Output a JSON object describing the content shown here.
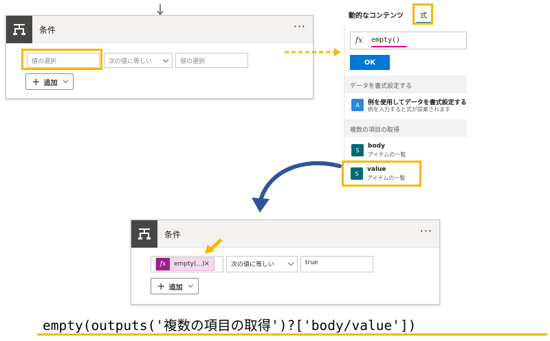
{
  "top_card": {
    "title": "条件",
    "more": "···",
    "field1_placeholder": "値の選択",
    "operator": "次の値に等しい",
    "field2_placeholder": "値の選択",
    "add_label": "追加"
  },
  "panel": {
    "tab_dynamic": "動的なコンテンツ",
    "tab_expression": "式",
    "fx_symbol": "fx",
    "expression_value": "empty()",
    "ok_label": "OK",
    "section_format": "データを書式設定する",
    "format_item_title": "例を使用してデータを書式設定する",
    "format_item_sub": "例を入力すると式が提案されます",
    "section_get_items": "複数の項目の取得",
    "items": [
      {
        "title": "body",
        "sub": "アイテムの一覧"
      },
      {
        "title": "value",
        "sub": "アイテムの一覧"
      }
    ]
  },
  "bottom_card": {
    "title": "条件",
    "more": "···",
    "token_fx": "fx",
    "token_label": "empty(...)",
    "token_remove": "×",
    "operator": "次の値に等しい",
    "value": "true",
    "add_label": "追加"
  },
  "expression_caption": "empty(outputs('複数の項目の取得')?['body/value'])",
  "colors": {
    "highlight": "#f4b800",
    "accent_blue": "#0078d4",
    "arrow_blue": "#2f5597",
    "sharepoint_teal": "#036c70",
    "token_purple": "#9b1f8b"
  },
  "icons": [
    "condition-icon",
    "plus-icon",
    "chevron-down-icon",
    "fx-icon",
    "format-data-icon",
    "sharepoint-icon",
    "close-icon",
    "more-icon"
  ]
}
